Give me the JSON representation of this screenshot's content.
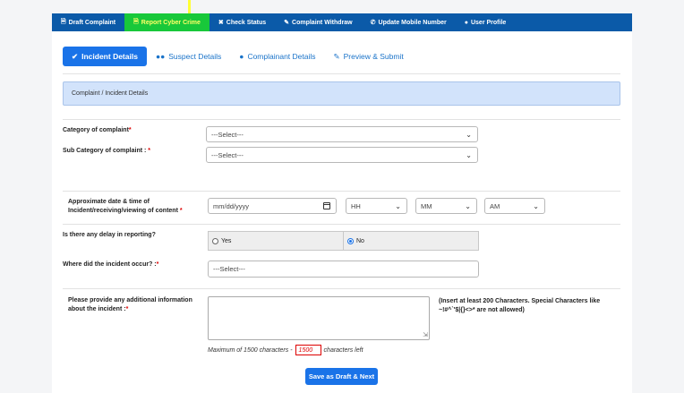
{
  "topnav": {
    "items": [
      {
        "label": "Draft Complaint",
        "icon": "file-icon"
      },
      {
        "label": "Report Cyber Crime",
        "icon": "file-icon"
      },
      {
        "label": "Check Status",
        "icon": "close-icon"
      },
      {
        "label": "Complaint Withdraw",
        "icon": "edit-icon"
      },
      {
        "label": "Update Mobile Number",
        "icon": "phone-icon"
      },
      {
        "label": "User Profile",
        "icon": "user-icon"
      }
    ]
  },
  "tabs": [
    {
      "label": "Incident Details",
      "icon": "check-icon"
    },
    {
      "label": "Suspect Details",
      "icon": "users-icon"
    },
    {
      "label": "Complainant Details",
      "icon": "user-icon"
    },
    {
      "label": "Preview & Submit",
      "icon": "edit-icon"
    }
  ],
  "section": {
    "title": "Complaint / Incident Details"
  },
  "form": {
    "category_label": "Category of complaint",
    "category_value": "---Select---",
    "subcategory_label": "Sub Category of complaint :",
    "subcategory_value": "---Select---",
    "date_label_1": "Approximate date & time of",
    "date_label_2": "Incident/receiving/viewing of content",
    "date_placeholder": "mm/dd/yyyy",
    "hour_value": "HH",
    "minute_value": "MM",
    "ampm_value": "AM",
    "delay_label": "Is there any delay in reporting?",
    "delay_yes": "Yes",
    "delay_no": "No",
    "location_label": "Where did the incident occur? :",
    "location_value": "---Select---",
    "info_label_1": "Please provide any additional information",
    "info_label_2": "about the incident :",
    "info_note": "(Insert at least 200 Characters. Special Characters like ~!#^`'$|{}<>* are not allowed)",
    "counter_prefix": "Maximum of 1500 characters -",
    "counter_value": "1500",
    "counter_suffix": "characters left",
    "save_label": "Save as Draft & Next",
    "required_mark": "*"
  },
  "colors": {
    "primary": "#1a73e8",
    "nav": "#0b5aa8",
    "active_nav": "#18c83a",
    "required": "#dd0000"
  }
}
